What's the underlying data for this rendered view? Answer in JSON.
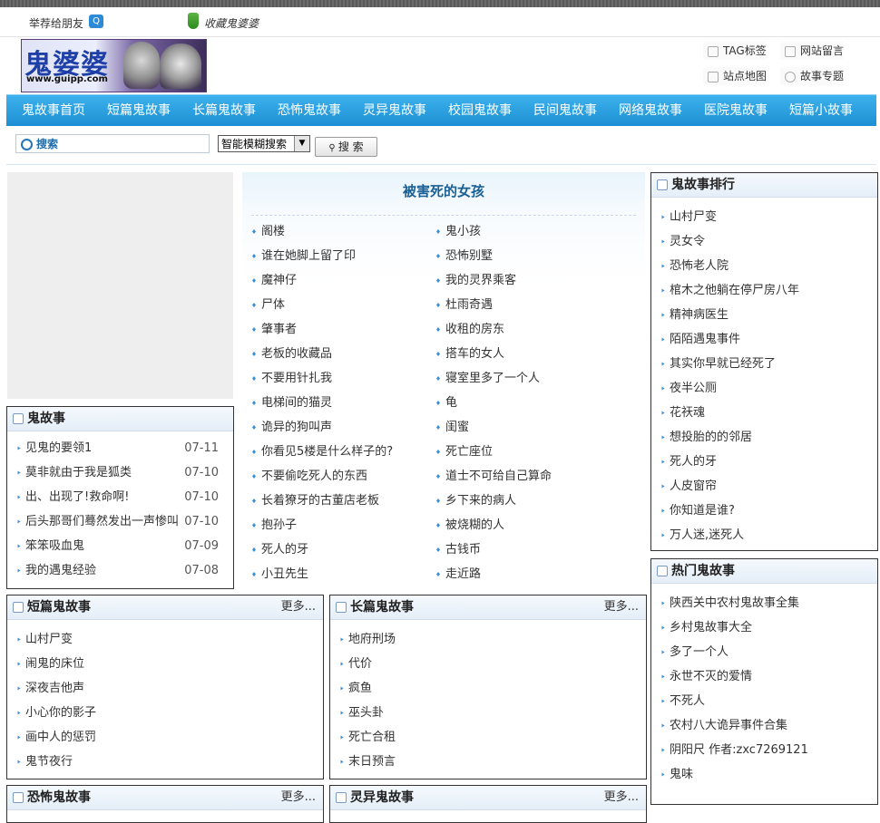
{
  "topbar": {
    "recommend": "举荐给朋友",
    "favorite": "收藏鬼婆婆"
  },
  "logo": {
    "title": "鬼婆婆",
    "url": "www.guipp.com"
  },
  "quick_links": [
    "TAG标签",
    "网站留言",
    "站点地图",
    "故事专题"
  ],
  "nav": [
    "鬼故事首页",
    "短篇鬼故事",
    "长篇鬼故事",
    "恐怖鬼故事",
    "灵异鬼故事",
    "校园鬼故事",
    "民间鬼故事",
    "网络鬼故事",
    "医院鬼故事",
    "短篇小故事"
  ],
  "search": {
    "placeholder": "搜索",
    "select": "智能模糊搜索",
    "button": "搜 索"
  },
  "feature": {
    "title": "被害死的女孩",
    "col1": [
      "阁楼",
      "谁在她脚上留了印",
      "魔神仔",
      "尸体",
      "肇事者",
      "老板的收藏品",
      "不要用针扎我",
      "电梯间的猫灵",
      "诡异的狗叫声",
      "你看见5楼是什么样子的?",
      "不要偷吃死人的东西",
      "长着獠牙的古董店老板",
      "抱孙子",
      "死人的牙",
      "小丑先生"
    ],
    "col2": [
      "鬼小孩",
      "恐怖别墅",
      "我的灵界乘客",
      "杜雨奇遇",
      "收租的房东",
      "搭车的女人",
      "寝室里多了一个人",
      "龟",
      "闺蜜",
      "死亡座位",
      "道士不可给自己算命",
      "乡下来的病人",
      "被烧糊的人",
      "古钱币",
      "走近路"
    ]
  },
  "guistory": {
    "title": "鬼故事",
    "items": [
      {
        "t": "见鬼的要领1",
        "d": "07-11"
      },
      {
        "t": "莫非就由于我是狐类",
        "d": "07-10"
      },
      {
        "t": "出、出现了!救命啊!",
        "d": "07-10"
      },
      {
        "t": "后头那哥们蓦然发出一声惨叫",
        "d": "07-10"
      },
      {
        "t": "笨笨吸血鬼",
        "d": "07-09"
      },
      {
        "t": "我的遇鬼经验",
        "d": "07-08"
      }
    ]
  },
  "ranking": {
    "title": "鬼故事排行",
    "items": [
      "山村尸变",
      "灵女令",
      "恐怖老人院",
      "棺木之他躺在停尸房八年",
      "精神病医生",
      "陌陌遇鬼事件",
      "其实你早就已经死了",
      "夜半公厕",
      "花祆魂",
      "想投胎的的邻居",
      "死人的牙",
      "人皮窗帘",
      "你知道是谁?",
      "万人迷,迷死人"
    ]
  },
  "hot": {
    "title": "热门鬼故事",
    "items": [
      "陕西关中农村鬼故事全集",
      "乡村鬼故事大全",
      "多了一个人",
      "永世不灭的爱情",
      "不死人",
      "农村八大诡异事件合集",
      "阴阳尺 作者:zxc7269121",
      "鬼味"
    ]
  },
  "short": {
    "title": "短篇鬼故事",
    "more": "更多...",
    "items": [
      "山村尸变",
      "闹鬼的床位",
      "深夜吉他声",
      "小心你的影子",
      "画中人的惩罚",
      "鬼节夜行"
    ]
  },
  "long": {
    "title": "长篇鬼故事",
    "more": "更多...",
    "items": [
      "地府刑场",
      "代价",
      "疯鱼",
      "巫头卦",
      "死亡合租",
      "末日预言"
    ]
  },
  "horror": {
    "title": "恐怖鬼故事",
    "more": "更多..."
  },
  "spirit": {
    "title": "灵异鬼故事",
    "more": "更多..."
  },
  "colors": {
    "nav": "#1d90d4",
    "accent": "#1a5f94"
  }
}
